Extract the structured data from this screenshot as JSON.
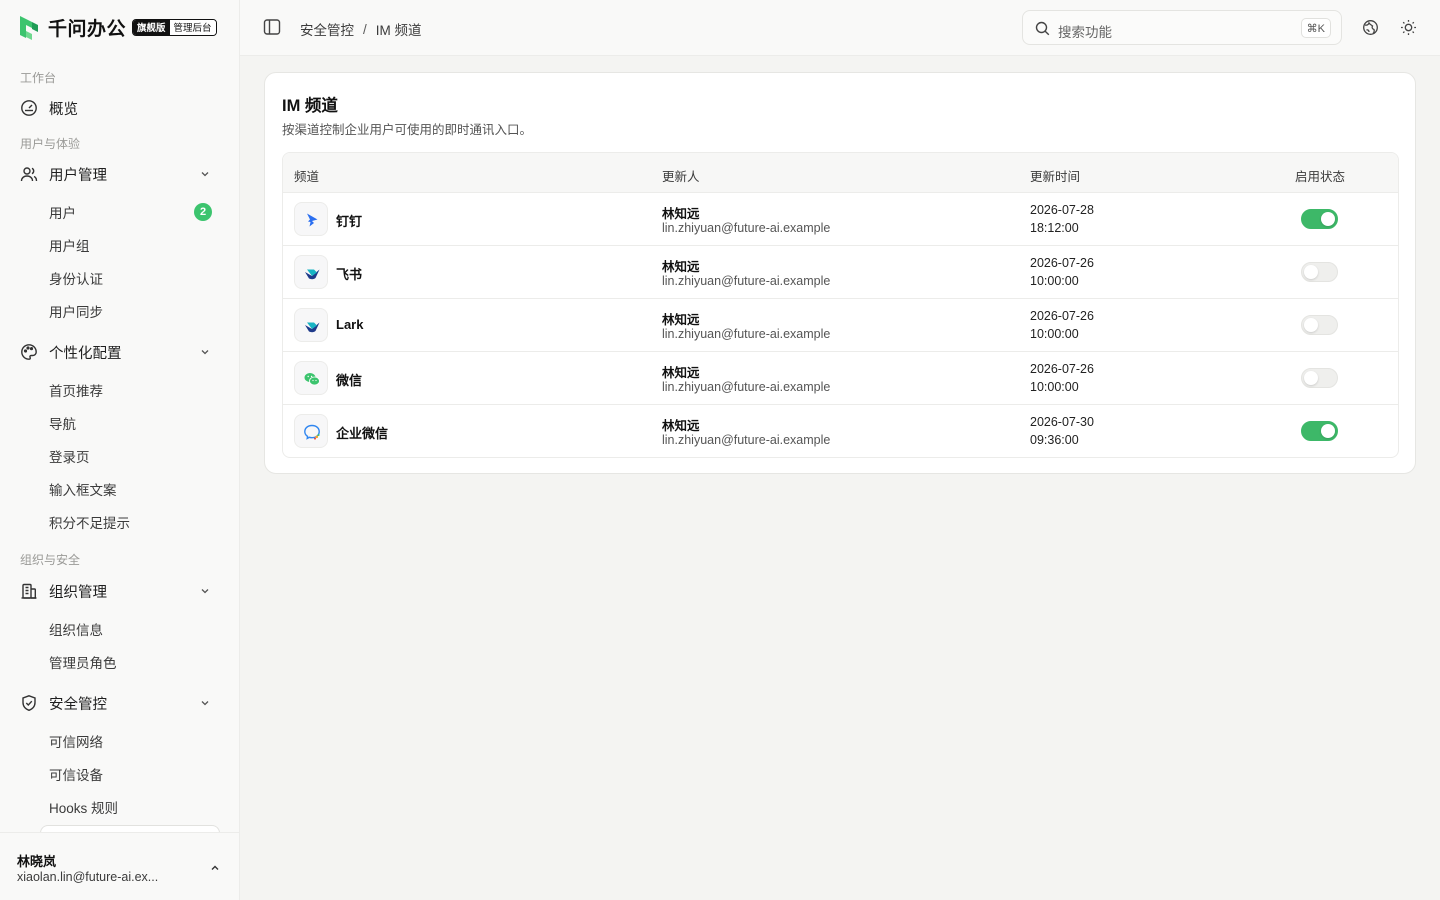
{
  "app": {
    "brand_name": "千问办公",
    "badge_edition": "旗舰版",
    "badge_admin": "管理后台"
  },
  "sidebar": {
    "sections": [
      {
        "label": "工作台"
      },
      {
        "label": "用户与体验"
      },
      {
        "label": "组织与安全"
      }
    ],
    "overview": {
      "label": "概览",
      "icon": "gauge-icon"
    },
    "user_mgmt": {
      "label": "用户管理",
      "icon": "users-icon",
      "items": [
        {
          "label": "用户",
          "badge": "2"
        },
        {
          "label": "用户组"
        },
        {
          "label": "身份认证"
        },
        {
          "label": "用户同步"
        }
      ]
    },
    "personalization": {
      "label": "个性化配置",
      "icon": "palette-icon",
      "items": [
        {
          "label": "首页推荐"
        },
        {
          "label": "导航"
        },
        {
          "label": "登录页"
        },
        {
          "label": "输入框文案"
        },
        {
          "label": "积分不足提示"
        }
      ]
    },
    "org_mgmt": {
      "label": "组织管理",
      "icon": "building-icon",
      "items": [
        {
          "label": "组织信息"
        },
        {
          "label": "管理员角色"
        }
      ]
    },
    "security": {
      "label": "安全管控",
      "icon": "shield-check-icon",
      "items": [
        {
          "label": "可信网络"
        },
        {
          "label": "可信设备"
        },
        {
          "label": "Hooks 规则"
        }
      ]
    },
    "user": {
      "name": "林晓岚",
      "email": "xiaolan.lin@future-ai.ex..."
    }
  },
  "header": {
    "breadcrumb": [
      "安全管控",
      "/",
      "IM 频道"
    ],
    "search_placeholder": "搜索功能",
    "search_shortcut": "⌘K"
  },
  "card": {
    "title": "IM 频道",
    "subtitle": "按渠道控制企业用户可使用的即时通讯入口。",
    "columns": [
      "频道",
      "更新人",
      "更新时间",
      "启用状态"
    ],
    "rows": [
      {
        "channel": "钉钉",
        "icon": "dingtalk-icon",
        "updater_name": "林知远",
        "updater_email": "lin.zhiyuan@future-ai.example",
        "date": "2026-07-28",
        "time": "18:12:00",
        "enabled": true
      },
      {
        "channel": "飞书",
        "icon": "feishu-icon",
        "updater_name": "林知远",
        "updater_email": "lin.zhiyuan@future-ai.example",
        "date": "2026-07-26",
        "time": "10:00:00",
        "enabled": false
      },
      {
        "channel": "Lark",
        "icon": "lark-icon",
        "updater_name": "林知远",
        "updater_email": "lin.zhiyuan@future-ai.example",
        "date": "2026-07-26",
        "time": "10:00:00",
        "enabled": false
      },
      {
        "channel": "微信",
        "icon": "wechat-icon",
        "updater_name": "林知远",
        "updater_email": "lin.zhiyuan@future-ai.example",
        "date": "2026-07-26",
        "time": "10:00:00",
        "enabled": false
      },
      {
        "channel": "企业微信",
        "icon": "wecom-icon",
        "updater_name": "林知远",
        "updater_email": "lin.zhiyuan@future-ai.example",
        "date": "2026-07-30",
        "time": "09:36:00",
        "enabled": true
      }
    ]
  },
  "colors": {
    "accent_green": "#3db868",
    "badge_green": "#3cc46e",
    "dingtalk_blue": "#2b6ff0",
    "feishu_teal": "#18b4c4",
    "wechat_green": "#3cc46e",
    "wecom_blue": "#2f86f0"
  }
}
